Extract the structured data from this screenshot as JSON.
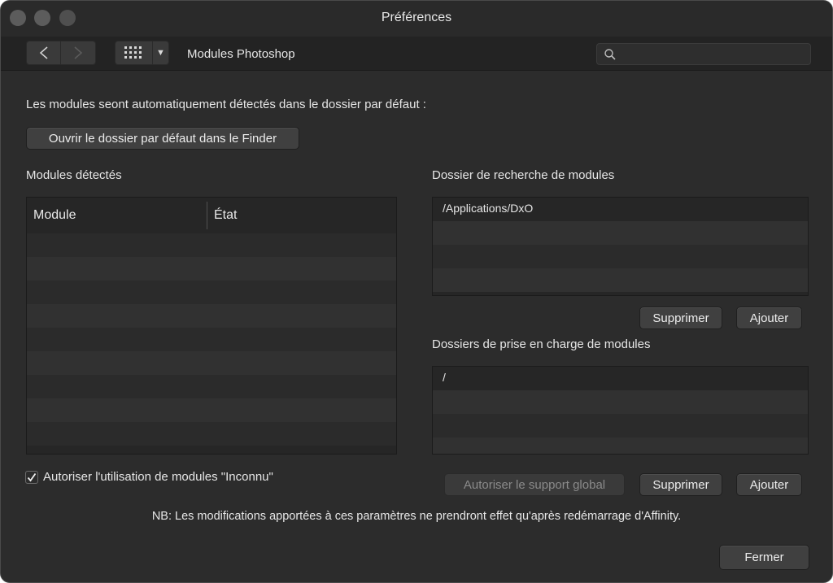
{
  "window": {
    "title": "Préférences"
  },
  "toolbar": {
    "section_title": "Modules Photoshop",
    "search": {
      "placeholder": "",
      "value": ""
    }
  },
  "main": {
    "intro_text": "Les modules seont automatiquement détectés dans le dossier par défaut :",
    "open_folder_button": "Ouvrir le dossier par défaut dans le Finder",
    "detected_modules": {
      "heading": "Modules détectés",
      "columns": [
        "Module",
        "État"
      ],
      "rows": []
    },
    "search_folders": {
      "heading": "Dossier de recherche de modules",
      "items": [
        "/Applications/DxO"
      ],
      "remove_button": "Supprimer",
      "add_button": "Ajouter"
    },
    "support_folders": {
      "heading": "Dossiers de prise en charge de modules",
      "items": [
        "/"
      ],
      "global_support_button": "Autoriser le support global",
      "remove_button": "Supprimer",
      "add_button": "Ajouter"
    },
    "allow_unknown": {
      "label": "Autoriser l'utilisation de modules \"Inconnu\"",
      "checked": true
    },
    "note": "NB: Les modifications apportées à ces paramètres ne prendront effet qu'après redémarrage d'Affinity.",
    "close_button": "Fermer"
  }
}
